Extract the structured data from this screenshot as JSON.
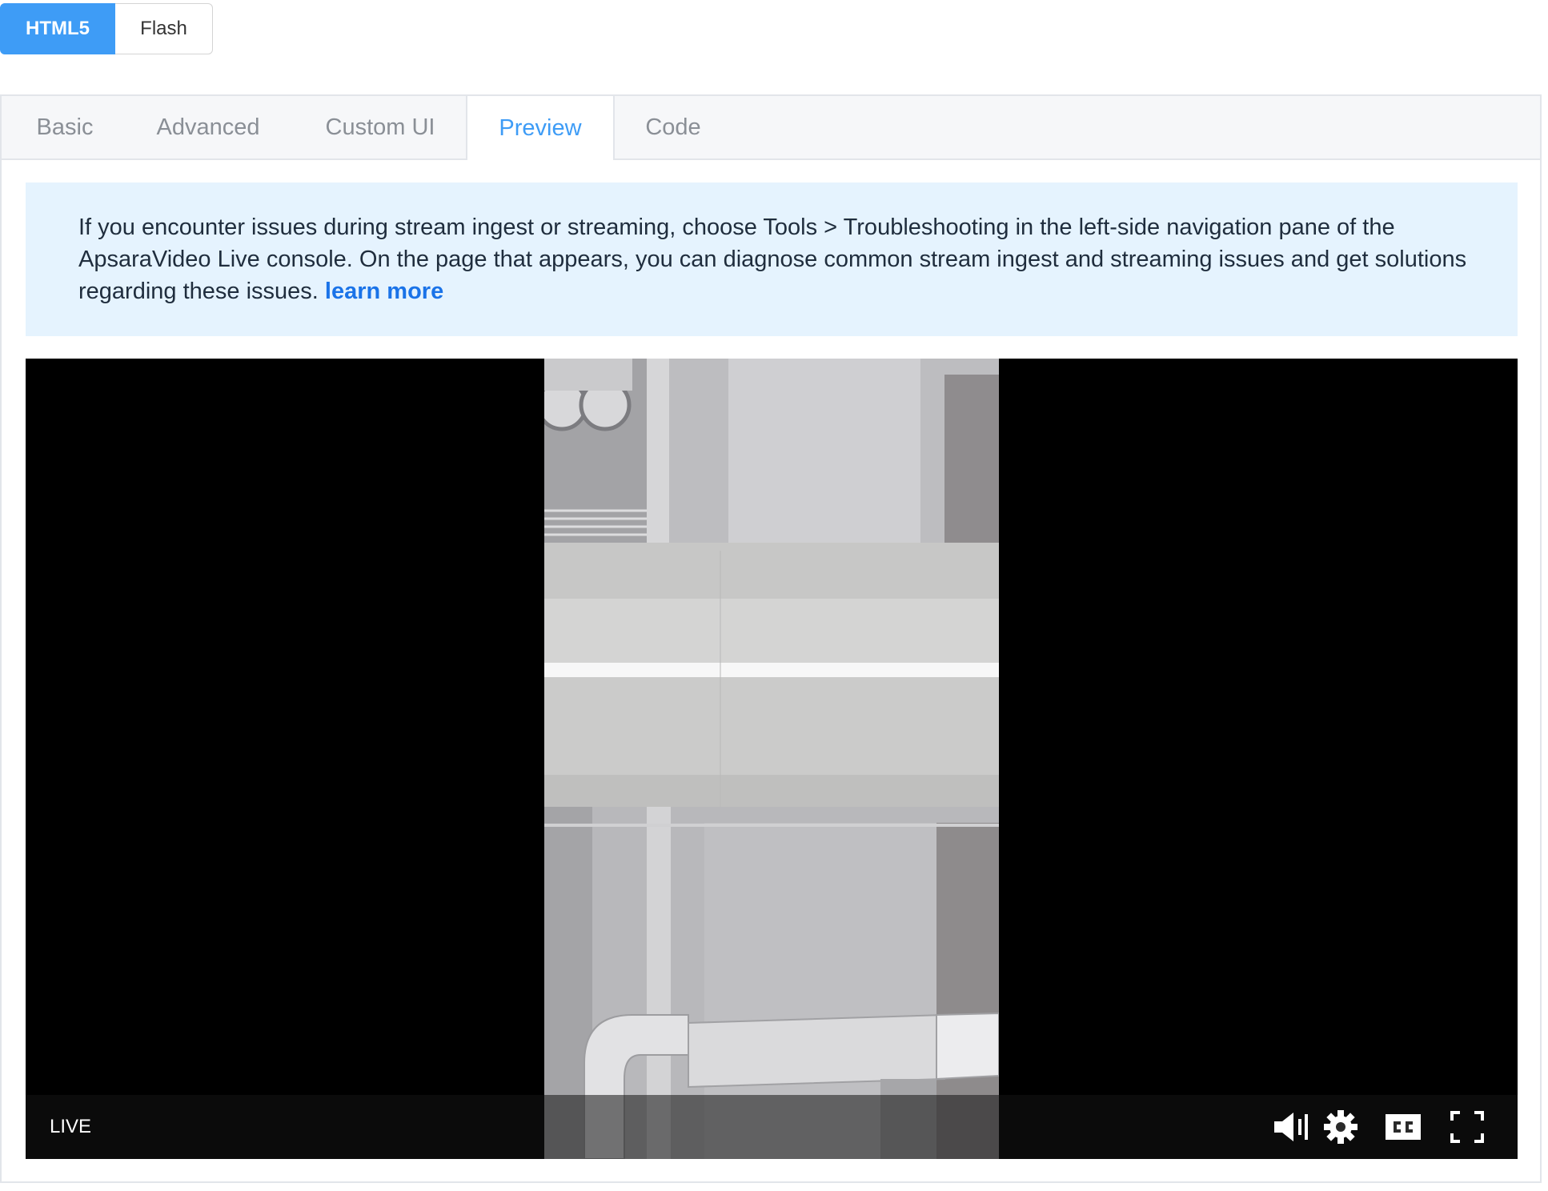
{
  "player_mode": {
    "active": "HTML5",
    "inactive": "Flash"
  },
  "tabs": [
    "Basic",
    "Advanced",
    "Custom UI",
    "Preview",
    "Code"
  ],
  "active_tab": "Preview",
  "notice": {
    "text": "If you encounter issues during stream ingest or streaming, choose Tools > Troubleshooting in the left-side navigation pane of the ApsaraVideo Live console. On the page that appears, you can diagnose common stream ingest and streaming issues and get solutions regarding these issues. ",
    "link": "learn more"
  },
  "player": {
    "live_label": "LIVE",
    "controls": [
      "volume-icon",
      "settings-gear-icon",
      "closed-captions-icon",
      "fullscreen-icon"
    ]
  },
  "colors": {
    "accent": "#3e9cf6",
    "link": "#1a73e8",
    "notice_bg": "#e5f3fe"
  }
}
